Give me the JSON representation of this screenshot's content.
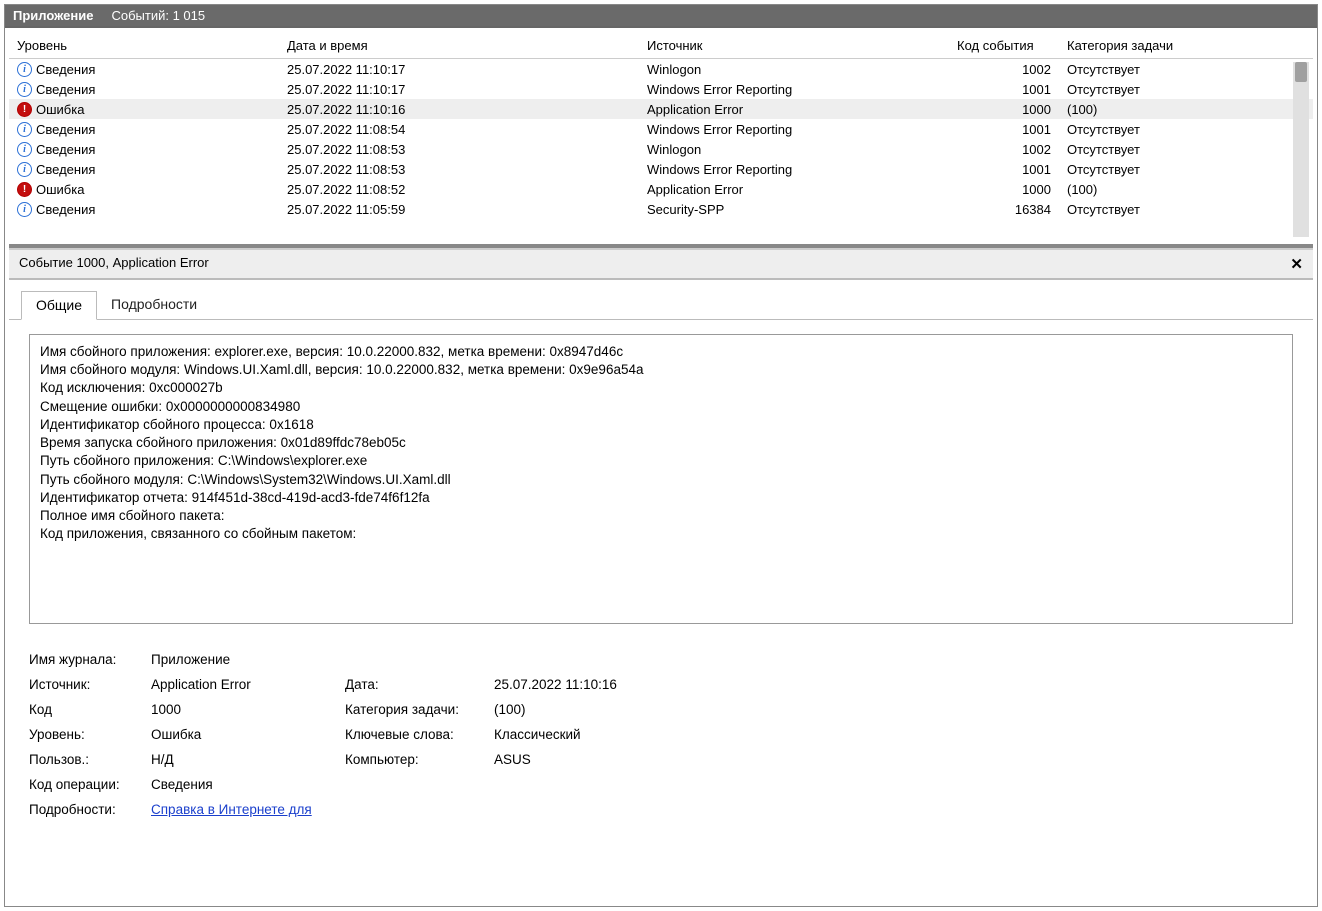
{
  "header": {
    "app_title": "Приложение",
    "event_count": "Событий: 1 015"
  },
  "columns": {
    "level": "Уровень",
    "datetime": "Дата и время",
    "source": "Источник",
    "event_id": "Код события",
    "task_category": "Категория задачи"
  },
  "rows": [
    {
      "type": "info",
      "level": "Сведения",
      "dt": "25.07.2022 11:10:17",
      "src": "Winlogon",
      "id": "1002",
      "cat": "Отсутствует",
      "sel": false
    },
    {
      "type": "info",
      "level": "Сведения",
      "dt": "25.07.2022 11:10:17",
      "src": "Windows Error Reporting",
      "id": "1001",
      "cat": "Отсутствует",
      "sel": false
    },
    {
      "type": "error",
      "level": "Ошибка",
      "dt": "25.07.2022 11:10:16",
      "src": "Application Error",
      "id": "1000",
      "cat": "(100)",
      "sel": true
    },
    {
      "type": "info",
      "level": "Сведения",
      "dt": "25.07.2022 11:08:54",
      "src": "Windows Error Reporting",
      "id": "1001",
      "cat": "Отсутствует",
      "sel": false
    },
    {
      "type": "info",
      "level": "Сведения",
      "dt": "25.07.2022 11:08:53",
      "src": "Winlogon",
      "id": "1002",
      "cat": "Отсутствует",
      "sel": false
    },
    {
      "type": "info",
      "level": "Сведения",
      "dt": "25.07.2022 11:08:53",
      "src": "Windows Error Reporting",
      "id": "1001",
      "cat": "Отсутствует",
      "sel": false
    },
    {
      "type": "error",
      "level": "Ошибка",
      "dt": "25.07.2022 11:08:52",
      "src": "Application Error",
      "id": "1000",
      "cat": "(100)",
      "sel": false
    },
    {
      "type": "info",
      "level": "Сведения",
      "dt": "25.07.2022 11:05:59",
      "src": "Security-SPP",
      "id": "16384",
      "cat": "Отсутствует",
      "sel": false
    }
  ],
  "detail": {
    "title": "Событие 1000, Application Error",
    "tab_general": "Общие",
    "tab_details": "Подробности",
    "body": "Имя сбойного приложения: explorer.exe, версия: 10.0.22000.832, метка времени: 0x8947d46c\nИмя сбойного модуля: Windows.UI.Xaml.dll, версия: 10.0.22000.832, метка времени: 0x9e96a54a\nКод исключения: 0xc000027b\nСмещение ошибки: 0x0000000000834980\nИдентификатор сбойного процесса: 0x1618\nВремя запуска сбойного приложения: 0x01d89ffdc78eb05c\nПуть сбойного приложения: C:\\Windows\\explorer.exe\nПуть сбойного модуля: C:\\Windows\\System32\\Windows.UI.Xaml.dll\nИдентификатор отчета: 914f451d-38cd-419d-acd3-fde74f6f12fa\nПолное имя сбойного пакета: \nКод приложения, связанного со сбойным пакетом: "
  },
  "props": {
    "log_name_lbl": "Имя журнала:",
    "log_name_val": "Приложение",
    "source_lbl": "Источник:",
    "source_val": "Application Error",
    "date_lbl": "Дата:",
    "date_val": "25.07.2022 11:10:16",
    "id_lbl": "Код",
    "id_val": "1000",
    "taskcat_lbl": "Категория задачи:",
    "taskcat_val": "(100)",
    "level_lbl": "Уровень:",
    "level_val": "Ошибка",
    "keywords_lbl": "Ключевые слова:",
    "keywords_val": "Классический",
    "user_lbl": "Пользов.:",
    "user_val": "Н/Д",
    "computer_lbl": "Компьютер:",
    "computer_val": "ASUS",
    "opcode_lbl": "Код операции:",
    "opcode_val": "Сведения",
    "moreinfo_lbl": "Подробности:",
    "moreinfo_link": "Справка в Интернете для "
  }
}
